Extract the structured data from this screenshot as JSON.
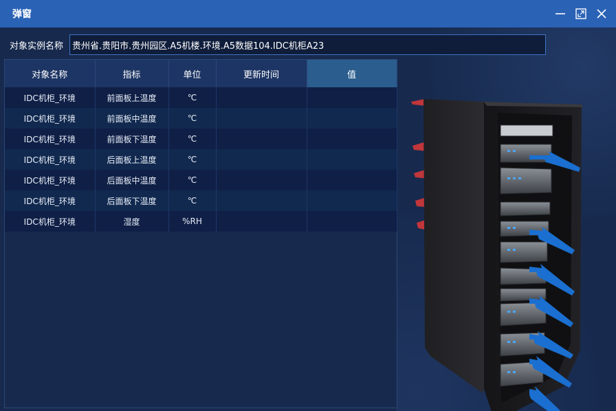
{
  "window": {
    "title": "弹窗"
  },
  "path": {
    "label": "对象实例名称",
    "value": "贵州省.贵阳市.贵州园区.A5机楼.环境.A5数据104.IDC机柜A23"
  },
  "table": {
    "columns": [
      "对象名称",
      "指标",
      "单位",
      "更新时间",
      "值"
    ],
    "rows": [
      [
        "IDC机柜_环境",
        "前面板上温度",
        "℃",
        "",
        ""
      ],
      [
        "IDC机柜_环境",
        "前面板中温度",
        "℃",
        "",
        ""
      ],
      [
        "IDC机柜_环境",
        "前面板下温度",
        "℃",
        "",
        ""
      ],
      [
        "IDC机柜_环境",
        "后面板上温度",
        "℃",
        "",
        ""
      ],
      [
        "IDC机柜_环境",
        "后面板中温度",
        "℃",
        "",
        ""
      ],
      [
        "IDC机柜_环境",
        "后面板下温度",
        "℃",
        "",
        ""
      ],
      [
        "IDC机柜_环境",
        "湿度",
        "%RH",
        "",
        ""
      ]
    ]
  },
  "icons": {
    "minimize": "minimize-icon",
    "maximize": "maximize-icon",
    "close": "close-icon",
    "rack": "server-rack-illustration"
  },
  "colors": {
    "titlebar": "#2a62b6",
    "background": "#172a4e",
    "header_active": "#2b5d8e",
    "cold_air_arrow": "#1a6fd0",
    "hot_air_arrow": "#c0363a"
  }
}
